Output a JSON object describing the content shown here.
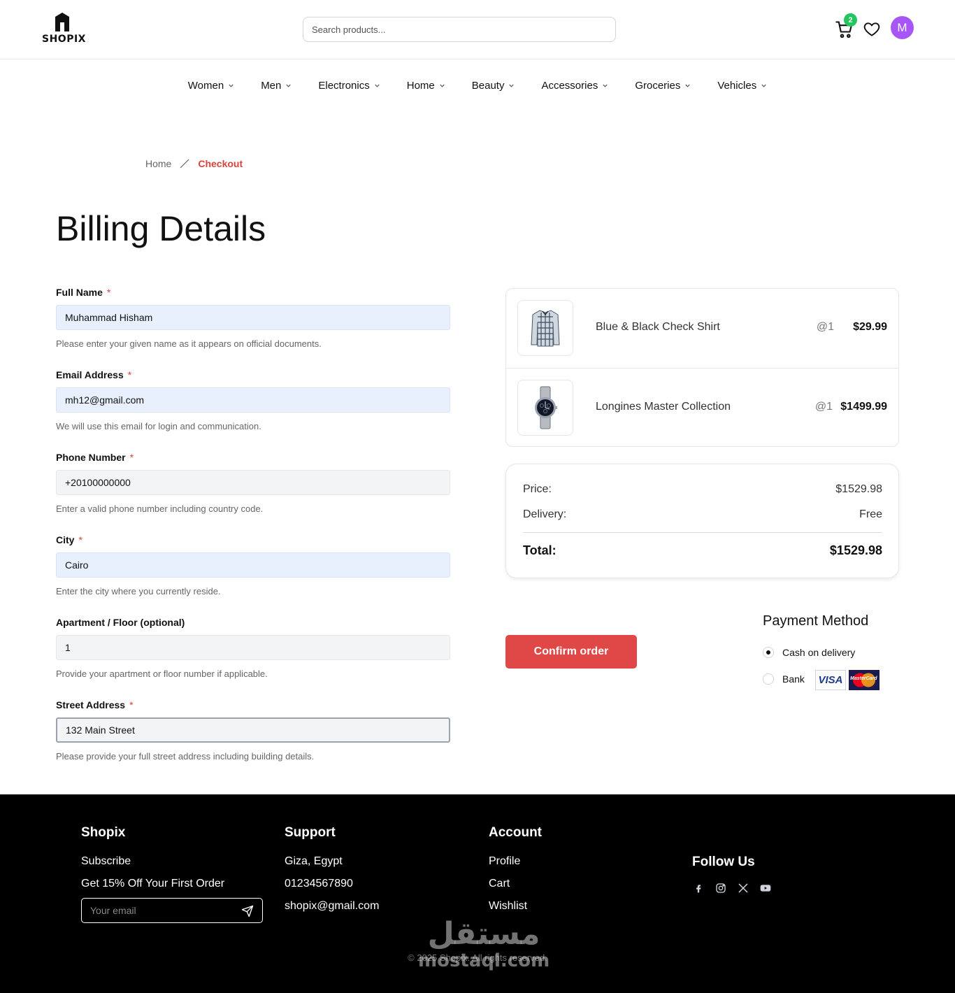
{
  "header": {
    "logo_text": "SHOPIX",
    "search_placeholder": "Search products...",
    "cart_count": "2",
    "avatar_initial": "M"
  },
  "nav": {
    "items": [
      {
        "label": "Women"
      },
      {
        "label": "Men"
      },
      {
        "label": "Electronics"
      },
      {
        "label": "Home"
      },
      {
        "label": "Beauty"
      },
      {
        "label": "Accessories"
      },
      {
        "label": "Groceries"
      },
      {
        "label": "Vehicles"
      }
    ]
  },
  "breadcrumb": {
    "home": "Home",
    "current": "Checkout"
  },
  "page_title": "Billing Details",
  "form": {
    "full_name": {
      "label": "Full Name",
      "value": "Muhammad Hisham",
      "help": "Please enter your given name as it appears on official documents."
    },
    "email": {
      "label": "Email Address",
      "value": "mh12@gmail.com",
      "help": "We will use this email for login and communication."
    },
    "phone": {
      "label": "Phone Number",
      "value": "+20100000000",
      "help": "Enter a valid phone number including country code."
    },
    "city": {
      "label": "City",
      "value": "Cairo",
      "help": "Enter the city where you currently reside."
    },
    "apartment": {
      "label": "Apartment / Floor (optional)",
      "value": "1",
      "help": "Provide your apartment or floor number if applicable."
    },
    "street": {
      "label": "Street Address",
      "value": "132 Main Street",
      "help": "Please provide your full street address including building details."
    },
    "required_mark": "*"
  },
  "order": {
    "items": [
      {
        "name": "Blue & Black Check Shirt",
        "qty": "@1",
        "price": "$29.99"
      },
      {
        "name": "Longines Master Collection",
        "qty": "@1",
        "price": "$1499.99"
      }
    ]
  },
  "summary": {
    "price_label": "Price:",
    "price_value": "$1529.98",
    "delivery_label": "Delivery:",
    "delivery_value": "Free",
    "total_label": "Total:",
    "total_value": "$1529.98"
  },
  "confirm_label": "Confirm order",
  "payment": {
    "title": "Payment Method",
    "options": [
      {
        "label": "Cash on delivery",
        "selected": true
      },
      {
        "label": "Bank",
        "selected": false
      }
    ],
    "visa_text": "VISA",
    "mastercard_text": "MasterCard"
  },
  "footer": {
    "brand": {
      "title": "Shopix",
      "subscribe": "Subscribe",
      "offer": "Get 15% Off Your First Order",
      "email_placeholder": "Your email"
    },
    "support": {
      "title": "Support",
      "address": "Giza, Egypt",
      "phone": "01234567890",
      "email": "shopix@gmail.com"
    },
    "account": {
      "title": "Account",
      "links": [
        "Profile",
        "Cart",
        "Wishlist"
      ]
    },
    "follow": {
      "title": "Follow Us"
    },
    "copyright": "© 2025 Shopix. All rights reserved.",
    "watermark_ar": "مستقل",
    "watermark_lat": "mostaql.com"
  }
}
